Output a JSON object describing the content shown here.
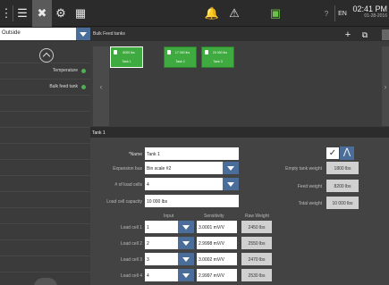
{
  "topbar": {
    "icons": [
      "menu-dots-icon",
      "list-icon",
      "tools-icon",
      "gear-icon",
      "grid-icon",
      "bell-icon",
      "warning-icon",
      "screen-icon",
      "help-icon"
    ],
    "help_label": "?",
    "language": "EN",
    "time": "02:41 PM",
    "date": "01-28-2016"
  },
  "location": {
    "selected": "Outside"
  },
  "breadcrumb": "Bulk Feed tanks",
  "toolbar": {
    "add_label": "+",
    "copy_label": "⧉"
  },
  "sidebar": {
    "items": [
      {
        "label": "Temperature",
        "status_color": "#4caf50"
      },
      {
        "label": "Bulk feed tank",
        "status_color": "#4caf50"
      }
    ]
  },
  "tanks": [
    {
      "value": "8000 lbs",
      "name": "Tank 1",
      "selected": true
    },
    {
      "value": "17 000 lbs",
      "name": "Tank 2",
      "selected": false
    },
    {
      "value": "20 000 lbs",
      "name": "Tank 3",
      "selected": false
    }
  ],
  "panel": {
    "title": "Tank 1",
    "fields": {
      "name_label": "*Name",
      "name_value": "Tank 1",
      "expansion_label": "Expansion bus",
      "expansion_value": "Bin scale #2",
      "loadcells_label": "# of load cells",
      "loadcells_value": "4",
      "capacity_label": "Load cell capacity",
      "capacity_value": "10 000 lbs"
    },
    "weights": {
      "empty_label": "Empty tank weight",
      "empty_value": "1800 lbs",
      "feed_label": "Feed weight",
      "feed_value": "8200 lbs",
      "total_label": "Total weight",
      "total_value": "10 000 lbs"
    },
    "table": {
      "headers": [
        "Input",
        "Sensitivity",
        "Raw Weight"
      ],
      "rows": [
        {
          "label": "Load cell 1",
          "input": "1",
          "sensitivity": "3.0001 mV/V",
          "raw": "2450 lbs"
        },
        {
          "label": "Load cell 2",
          "input": "2",
          "sensitivity": "2.9998 mV/V",
          "raw": "2550 lbs"
        },
        {
          "label": "Load cell 3",
          "input": "3",
          "sensitivity": "3.0002 mV/V",
          "raw": "2470 lbs"
        },
        {
          "label": "Load cell 4",
          "input": "4",
          "sensitivity": "2.9997 mV/V",
          "raw": "2530 lbs"
        }
      ]
    },
    "ok_label": "✓",
    "step_label": "⋀"
  },
  "colors": {
    "accent": "#4a6d99",
    "status_green": "#3faa3f",
    "topbar_bg": "#2b2b2b"
  }
}
